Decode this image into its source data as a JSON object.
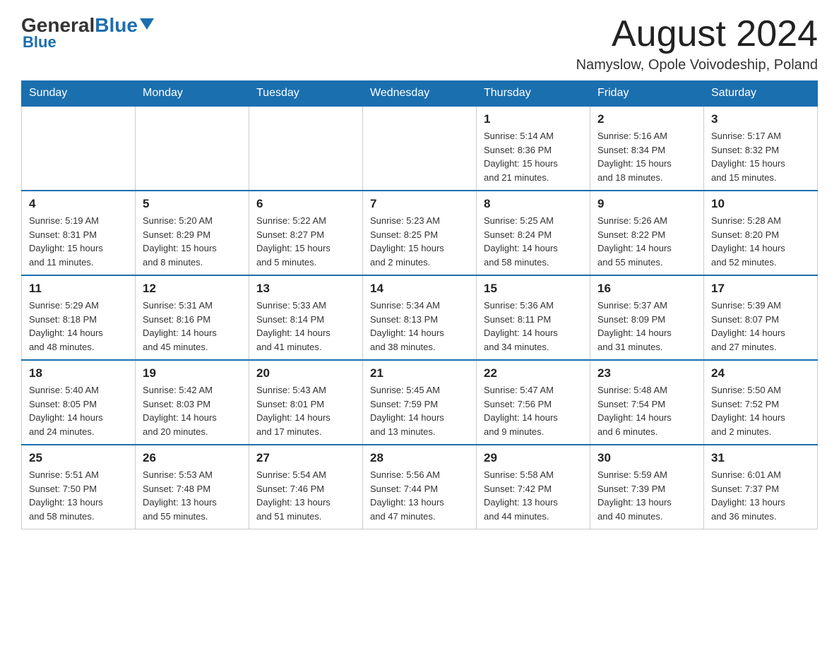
{
  "header": {
    "logo_general": "General",
    "logo_blue": "Blue",
    "month_title": "August 2024",
    "location": "Namyslow, Opole Voivodeship, Poland"
  },
  "days_of_week": [
    "Sunday",
    "Monday",
    "Tuesday",
    "Wednesday",
    "Thursday",
    "Friday",
    "Saturday"
  ],
  "weeks": [
    [
      {
        "day": "",
        "info": ""
      },
      {
        "day": "",
        "info": ""
      },
      {
        "day": "",
        "info": ""
      },
      {
        "day": "",
        "info": ""
      },
      {
        "day": "1",
        "info": "Sunrise: 5:14 AM\nSunset: 8:36 PM\nDaylight: 15 hours\nand 21 minutes."
      },
      {
        "day": "2",
        "info": "Sunrise: 5:16 AM\nSunset: 8:34 PM\nDaylight: 15 hours\nand 18 minutes."
      },
      {
        "day": "3",
        "info": "Sunrise: 5:17 AM\nSunset: 8:32 PM\nDaylight: 15 hours\nand 15 minutes."
      }
    ],
    [
      {
        "day": "4",
        "info": "Sunrise: 5:19 AM\nSunset: 8:31 PM\nDaylight: 15 hours\nand 11 minutes."
      },
      {
        "day": "5",
        "info": "Sunrise: 5:20 AM\nSunset: 8:29 PM\nDaylight: 15 hours\nand 8 minutes."
      },
      {
        "day": "6",
        "info": "Sunrise: 5:22 AM\nSunset: 8:27 PM\nDaylight: 15 hours\nand 5 minutes."
      },
      {
        "day": "7",
        "info": "Sunrise: 5:23 AM\nSunset: 8:25 PM\nDaylight: 15 hours\nand 2 minutes."
      },
      {
        "day": "8",
        "info": "Sunrise: 5:25 AM\nSunset: 8:24 PM\nDaylight: 14 hours\nand 58 minutes."
      },
      {
        "day": "9",
        "info": "Sunrise: 5:26 AM\nSunset: 8:22 PM\nDaylight: 14 hours\nand 55 minutes."
      },
      {
        "day": "10",
        "info": "Sunrise: 5:28 AM\nSunset: 8:20 PM\nDaylight: 14 hours\nand 52 minutes."
      }
    ],
    [
      {
        "day": "11",
        "info": "Sunrise: 5:29 AM\nSunset: 8:18 PM\nDaylight: 14 hours\nand 48 minutes."
      },
      {
        "day": "12",
        "info": "Sunrise: 5:31 AM\nSunset: 8:16 PM\nDaylight: 14 hours\nand 45 minutes."
      },
      {
        "day": "13",
        "info": "Sunrise: 5:33 AM\nSunset: 8:14 PM\nDaylight: 14 hours\nand 41 minutes."
      },
      {
        "day": "14",
        "info": "Sunrise: 5:34 AM\nSunset: 8:13 PM\nDaylight: 14 hours\nand 38 minutes."
      },
      {
        "day": "15",
        "info": "Sunrise: 5:36 AM\nSunset: 8:11 PM\nDaylight: 14 hours\nand 34 minutes."
      },
      {
        "day": "16",
        "info": "Sunrise: 5:37 AM\nSunset: 8:09 PM\nDaylight: 14 hours\nand 31 minutes."
      },
      {
        "day": "17",
        "info": "Sunrise: 5:39 AM\nSunset: 8:07 PM\nDaylight: 14 hours\nand 27 minutes."
      }
    ],
    [
      {
        "day": "18",
        "info": "Sunrise: 5:40 AM\nSunset: 8:05 PM\nDaylight: 14 hours\nand 24 minutes."
      },
      {
        "day": "19",
        "info": "Sunrise: 5:42 AM\nSunset: 8:03 PM\nDaylight: 14 hours\nand 20 minutes."
      },
      {
        "day": "20",
        "info": "Sunrise: 5:43 AM\nSunset: 8:01 PM\nDaylight: 14 hours\nand 17 minutes."
      },
      {
        "day": "21",
        "info": "Sunrise: 5:45 AM\nSunset: 7:59 PM\nDaylight: 14 hours\nand 13 minutes."
      },
      {
        "day": "22",
        "info": "Sunrise: 5:47 AM\nSunset: 7:56 PM\nDaylight: 14 hours\nand 9 minutes."
      },
      {
        "day": "23",
        "info": "Sunrise: 5:48 AM\nSunset: 7:54 PM\nDaylight: 14 hours\nand 6 minutes."
      },
      {
        "day": "24",
        "info": "Sunrise: 5:50 AM\nSunset: 7:52 PM\nDaylight: 14 hours\nand 2 minutes."
      }
    ],
    [
      {
        "day": "25",
        "info": "Sunrise: 5:51 AM\nSunset: 7:50 PM\nDaylight: 13 hours\nand 58 minutes."
      },
      {
        "day": "26",
        "info": "Sunrise: 5:53 AM\nSunset: 7:48 PM\nDaylight: 13 hours\nand 55 minutes."
      },
      {
        "day": "27",
        "info": "Sunrise: 5:54 AM\nSunset: 7:46 PM\nDaylight: 13 hours\nand 51 minutes."
      },
      {
        "day": "28",
        "info": "Sunrise: 5:56 AM\nSunset: 7:44 PM\nDaylight: 13 hours\nand 47 minutes."
      },
      {
        "day": "29",
        "info": "Sunrise: 5:58 AM\nSunset: 7:42 PM\nDaylight: 13 hours\nand 44 minutes."
      },
      {
        "day": "30",
        "info": "Sunrise: 5:59 AM\nSunset: 7:39 PM\nDaylight: 13 hours\nand 40 minutes."
      },
      {
        "day": "31",
        "info": "Sunrise: 6:01 AM\nSunset: 7:37 PM\nDaylight: 13 hours\nand 36 minutes."
      }
    ]
  ]
}
